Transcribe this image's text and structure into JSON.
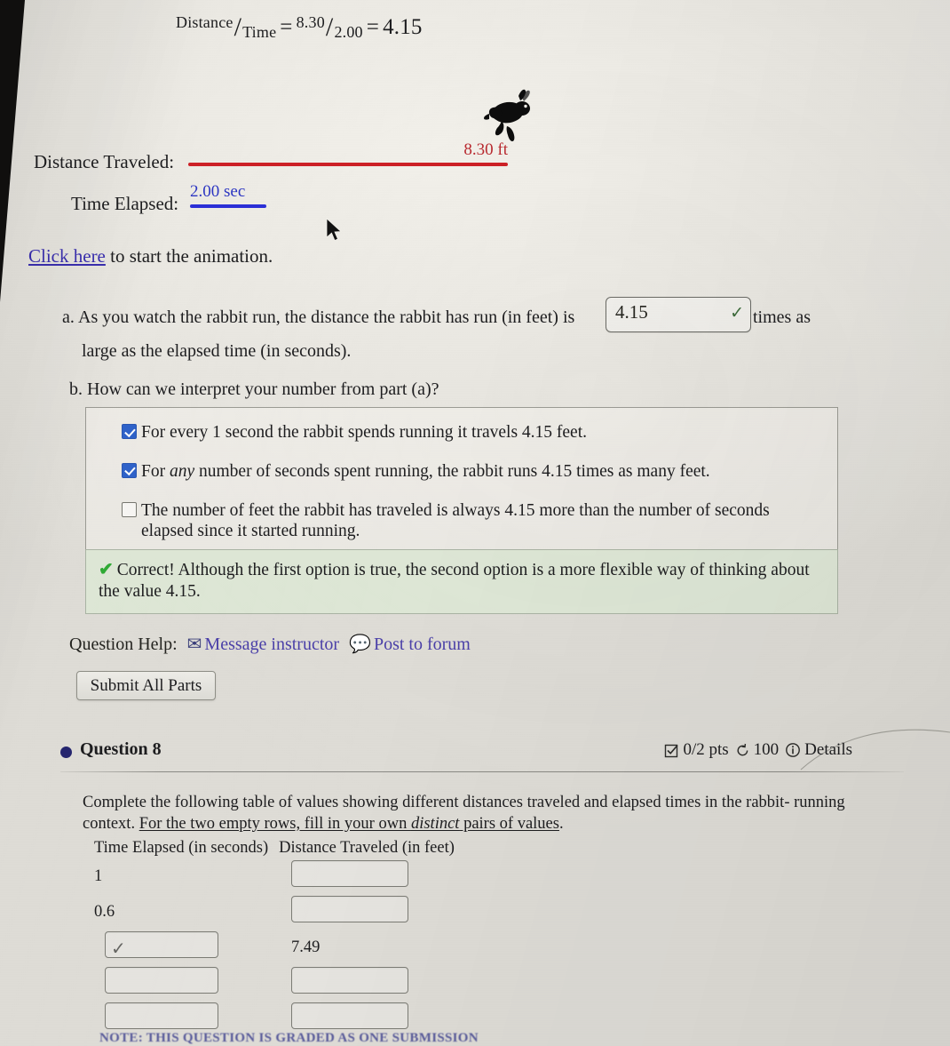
{
  "formula": {
    "numerator_word": "Distance",
    "denominator_word": "Time",
    "equals_1": "=",
    "numerator_value": "8.30",
    "denominator_value": "2.00",
    "equals_2": "=",
    "result": "4.15"
  },
  "readouts": {
    "distance_label": "Distance Traveled:",
    "distance_value": "8.30 ft",
    "distance_color": "#cc2026",
    "time_label": "Time Elapsed:",
    "time_value": "2.00 sec",
    "time_color": "#2b2fd6"
  },
  "animation": {
    "link_text": "Click here",
    "rest_text": " to start the animation.",
    "link_color": "#3a2fb0"
  },
  "part_a": {
    "letter": "a.",
    "text_before": "As you watch the rabbit run, the distance the rabbit has run (in feet) is",
    "input_value": "4.15",
    "input_placeholder": "",
    "text_after": "times as",
    "line_two": "large as the elapsed time (in seconds).",
    "validation_mark": "✓",
    "validation_color": "#3c6b3a"
  },
  "part_b": {
    "letter": "b.",
    "question": "How can we interpret your number from part (a)?",
    "options": [
      {
        "checked": true,
        "text": "For every 1 second the rabbit spends running it travels 4.15 feet."
      },
      {
        "checked": true,
        "text_pre": "For ",
        "emphasis": "any",
        "text_post": " number of seconds spent running, the rabbit runs 4.15 times as many feet."
      },
      {
        "checked": false,
        "text": "The number of feet the rabbit has traveled is always 4.15 more than the number of seconds elapsed since it started running."
      }
    ],
    "stray_mark": "✓",
    "feedback": {
      "icon": "green-check",
      "text": "Correct! Although the first option is true, the second option is a more flexible way of thinking about the value 4.15.",
      "background": "#dde6d5"
    }
  },
  "question_help": {
    "label": "Question Help:",
    "message_instructor": "Message instructor",
    "message_icon": "envelope-icon",
    "post_forum": "Post to forum",
    "post_icon": "speech-bubble-icon",
    "link_color": "#4a3fa8"
  },
  "submit": {
    "label": "Submit All Parts"
  },
  "question8": {
    "title": "Question 8",
    "bullet_color": "#25256e",
    "points": "0/2 pts",
    "points_icon": "check-square-icon",
    "attempts": "100",
    "attempts_icon": "retry-arrow-icon",
    "details": "Details",
    "details_icon": "info-circle-icon",
    "body_line1": "Complete the following table of values showing different distances traveled and elapsed times in the rabbit-",
    "body_line2_pre": "running context. ",
    "body_line2_u_pre": "For the two empty rows, fill in your own ",
    "body_line2_em": "distinct",
    "body_line2_u_post": " pairs of values",
    "body_line2_end": ".",
    "table": {
      "headers": [
        "Time Elapsed (in seconds)",
        "Distance Traveled (in feet)"
      ],
      "rows": [
        {
          "time": "1",
          "time_input": false,
          "distance": "",
          "distance_input": true
        },
        {
          "time": "0.6",
          "time_input": false,
          "distance": "",
          "distance_input": true
        },
        {
          "time": "",
          "time_input": true,
          "distance": "7.49",
          "distance_input": false
        },
        {
          "time": "",
          "time_input": true,
          "distance": "",
          "distance_input": true
        },
        {
          "time": "",
          "time_input": true,
          "distance": "",
          "distance_input": true
        }
      ]
    },
    "bottom_note": "NOTE: THIS QUESTION IS GRADED AS ONE SUBMISSION"
  }
}
